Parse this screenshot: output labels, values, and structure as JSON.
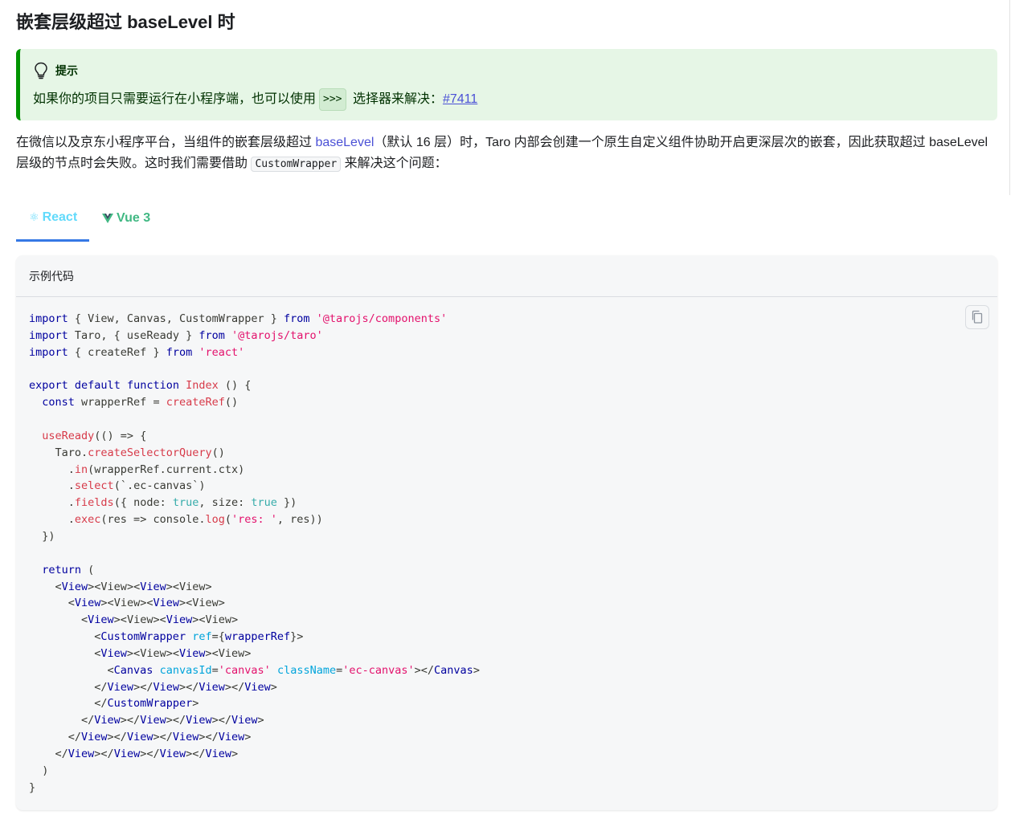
{
  "heading": "嵌套层级超过 baseLevel 时",
  "tip": {
    "label": "提示",
    "text_before": "如果你的项目只需要运行在小程序端，也可以使用",
    "code": ">>>",
    "text_after": " 选择器来解决：",
    "link": "#7411",
    "icon": "lightbulb-icon"
  },
  "paragraph": {
    "part1": "在微信以及京东小程序平台，当组件的嵌套层级超过 ",
    "link": "baseLevel",
    "part2": "（默认 16 层）时，Taro 内部会创建一个原生自定义组件协助开启更深层次的嵌套，因此获取超过 baseLevel 层级的节点时会失败。这时我们需要借助 ",
    "code": "CustomWrapper",
    "part3": " 来解决这个问题："
  },
  "tabs": [
    {
      "label": "React",
      "icon": "react-icon",
      "active": true
    },
    {
      "label": "Vue 3",
      "icon": "vue-icon",
      "active": false
    }
  ],
  "codeblock": {
    "title": "示例代码",
    "copy_icon": "copy-icon"
  },
  "colors": {
    "tip_bg": "#e6f6e6",
    "tip_border": "#009400",
    "react_tab": "#61dafb",
    "vue_tab": "#41b883",
    "active_underline": "#3578e5"
  }
}
